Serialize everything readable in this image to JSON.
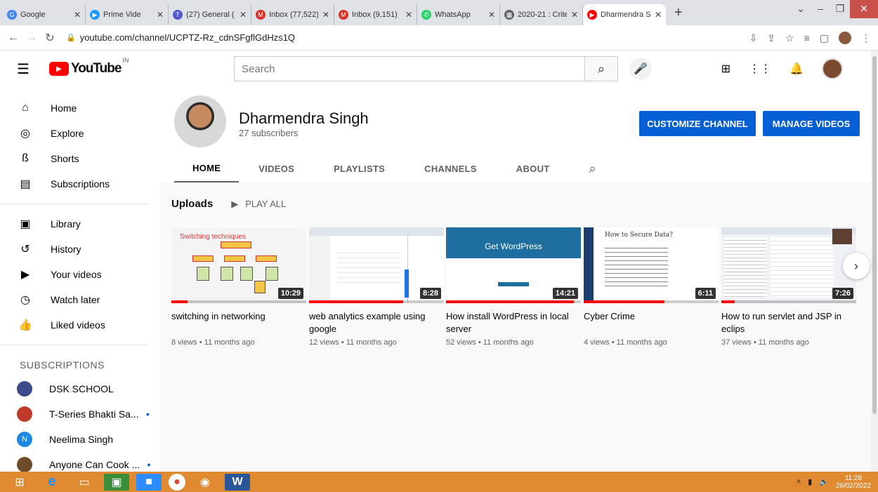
{
  "browser": {
    "tabs": [
      {
        "title": "Google",
        "color": "#4285f4",
        "icon": "G"
      },
      {
        "title": "Prime Vide",
        "color": "#1a98ff",
        "icon": "▶"
      },
      {
        "title": "(27) General (",
        "color": "#5059c9",
        "icon": "T"
      },
      {
        "title": "Inbox (77,522)",
        "color": "#d93025",
        "icon": "M"
      },
      {
        "title": "Inbox (9,151)",
        "color": "#d93025",
        "icon": "M"
      },
      {
        "title": "WhatsApp",
        "color": "#25d366",
        "icon": "✆"
      },
      {
        "title": "2020-21 : Crite",
        "color": "#5f6368",
        "icon": "▦"
      },
      {
        "title": "Dharmendra S",
        "color": "#ff0000",
        "icon": "▶"
      }
    ],
    "url": "youtube.com/channel/UCPTZ-Rz_cdnSFgflGdHzs1Q"
  },
  "yt": {
    "logo_text": "YouTube",
    "country": "IN",
    "search_placeholder": "Search"
  },
  "sidebar": {
    "main": [
      {
        "label": "Home",
        "icon": "⌂",
        "name": "home-icon"
      },
      {
        "label": "Explore",
        "icon": "◎",
        "name": "explore-icon"
      },
      {
        "label": "Shorts",
        "icon": "ß",
        "name": "shorts-icon"
      },
      {
        "label": "Subscriptions",
        "icon": "▤",
        "name": "subscriptions-icon"
      }
    ],
    "library": [
      {
        "label": "Library",
        "icon": "▣",
        "name": "library-icon"
      },
      {
        "label": "History",
        "icon": "↺",
        "name": "history-icon"
      },
      {
        "label": "Your videos",
        "icon": "▶",
        "name": "your-videos-icon"
      },
      {
        "label": "Watch later",
        "icon": "◷",
        "name": "watch-later-icon"
      },
      {
        "label": "Liked videos",
        "icon": "👍",
        "name": "liked-videos-icon"
      }
    ],
    "subs_heading": "SUBSCRIPTIONS",
    "subs": [
      {
        "label": "DSK SCHOOL",
        "color": "#3b4b8c",
        "initial": "",
        "live": false
      },
      {
        "label": "T-Series Bhakti Sa...",
        "color": "#c0392b",
        "initial": "",
        "live": true
      },
      {
        "label": "Neelima Singh",
        "color": "#1e88e5",
        "initial": "N",
        "live": false
      },
      {
        "label": "Anyone Can Cook ...",
        "color": "#6d4c2a",
        "initial": "",
        "live": true
      }
    ]
  },
  "channel": {
    "name": "Dharmendra Singh",
    "subscribers": "27 subscribers",
    "customize_label": "CUSTOMIZE CHANNEL",
    "manage_label": "MANAGE VIDEOS",
    "tabs": [
      "HOME",
      "VIDEOS",
      "PLAYLISTS",
      "CHANNELS",
      "ABOUT"
    ]
  },
  "uploads": {
    "heading": "Uploads",
    "play_all": "PLAY ALL",
    "videos": [
      {
        "title": "switching in networking",
        "meta": "8 views • 11 months ago",
        "duration": "10:29",
        "progress": 0.12,
        "bg": "#f4f4f4",
        "thumb_text": "Switching techniques"
      },
      {
        "title": "web analytics example using google",
        "meta": "12 views • 11 months ago",
        "duration": "8:28",
        "progress": 0.7,
        "bg": "#ffffff",
        "thumb_text": ""
      },
      {
        "title": "How install WordPress in local server",
        "meta": "52 views • 11 months ago",
        "duration": "14:21",
        "progress": 0.95,
        "bg": "#1e6f9f",
        "thumb_text": "Get WordPress"
      },
      {
        "title": "Cyber Crime",
        "meta": "4 views • 11 months ago",
        "duration": "6:11",
        "progress": 0.6,
        "bg": "#ffffff",
        "thumb_text": "How to Secure Data?"
      },
      {
        "title": "How to run servlet and JSP in eclips",
        "meta": "37 views • 11 months ago",
        "duration": "7:26",
        "progress": 0.1,
        "bg": "#eef1f6",
        "thumb_text": ""
      }
    ]
  },
  "taskbar": {
    "time": "11:28",
    "date": "26/02/2022"
  }
}
